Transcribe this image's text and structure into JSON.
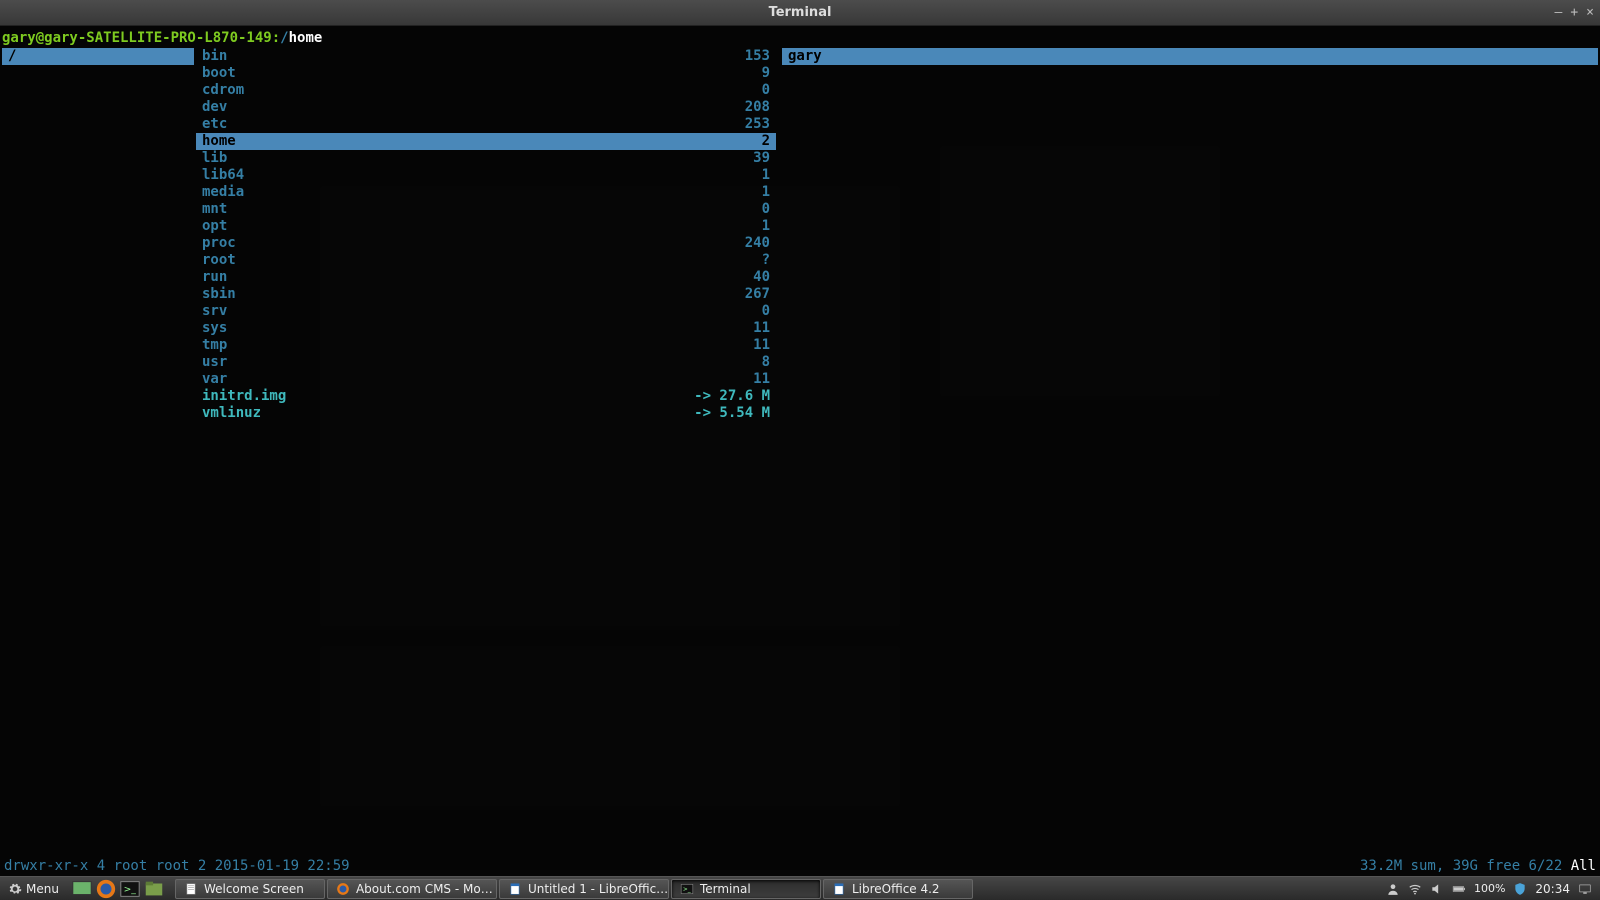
{
  "window": {
    "title": "Terminal",
    "min": "—",
    "max": "+",
    "close": "×"
  },
  "path": {
    "userhost": "gary@gary-SATELLITE-PRO-L870-149:",
    "root": "/",
    "cur": "home"
  },
  "parent_col": {
    "items": [
      {
        "name": "/",
        "selected": true
      }
    ]
  },
  "main_col": {
    "items": [
      {
        "name": "bin",
        "info": "153",
        "type": "dir"
      },
      {
        "name": "boot",
        "info": "9",
        "type": "dir"
      },
      {
        "name": "cdrom",
        "info": "0",
        "type": "dir"
      },
      {
        "name": "dev",
        "info": "208",
        "type": "dir"
      },
      {
        "name": "etc",
        "info": "253",
        "type": "dir"
      },
      {
        "name": "home",
        "info": "2",
        "type": "dir",
        "selected": true
      },
      {
        "name": "lib",
        "info": "39",
        "type": "dir"
      },
      {
        "name": "lib64",
        "info": "1",
        "type": "dir"
      },
      {
        "name": "media",
        "info": "1",
        "type": "dir"
      },
      {
        "name": "mnt",
        "info": "0",
        "type": "dir"
      },
      {
        "name": "opt",
        "info": "1",
        "type": "dir"
      },
      {
        "name": "proc",
        "info": "240",
        "type": "dir"
      },
      {
        "name": "root",
        "info": "?",
        "type": "dir"
      },
      {
        "name": "run",
        "info": "40",
        "type": "dir"
      },
      {
        "name": "sbin",
        "info": "267",
        "type": "dir"
      },
      {
        "name": "srv",
        "info": "0",
        "type": "dir"
      },
      {
        "name": "sys",
        "info": "11",
        "type": "dir"
      },
      {
        "name": "tmp",
        "info": "11",
        "type": "dir"
      },
      {
        "name": "usr",
        "info": "8",
        "type": "dir"
      },
      {
        "name": "var",
        "info": "11",
        "type": "dir"
      },
      {
        "name": "initrd.img",
        "info": "-> 27.6 M",
        "type": "link"
      },
      {
        "name": "vmlinuz",
        "info": "-> 5.54 M",
        "type": "link"
      }
    ]
  },
  "child_col": {
    "items": [
      {
        "name": "gary",
        "type": "dir",
        "selected": true
      }
    ]
  },
  "status": {
    "left": "drwxr-xr-x 4 root root 2 2015-01-19 22:59",
    "right_a": "33.2M sum, 39G free  6/22  ",
    "right_b": "All"
  },
  "taskbar": {
    "menu": "Menu",
    "tasks": [
      {
        "label": "Welcome Screen",
        "icon": "doc"
      },
      {
        "label": "About.com CMS - Mo…",
        "icon": "firefox"
      },
      {
        "label": "Untitled 1 - LibreOffic…",
        "icon": "writer"
      },
      {
        "label": "Terminal",
        "icon": "terminal",
        "active": true
      },
      {
        "label": "LibreOffice 4.2",
        "icon": "writer"
      }
    ],
    "battery": "100%",
    "clock": "20:34"
  }
}
